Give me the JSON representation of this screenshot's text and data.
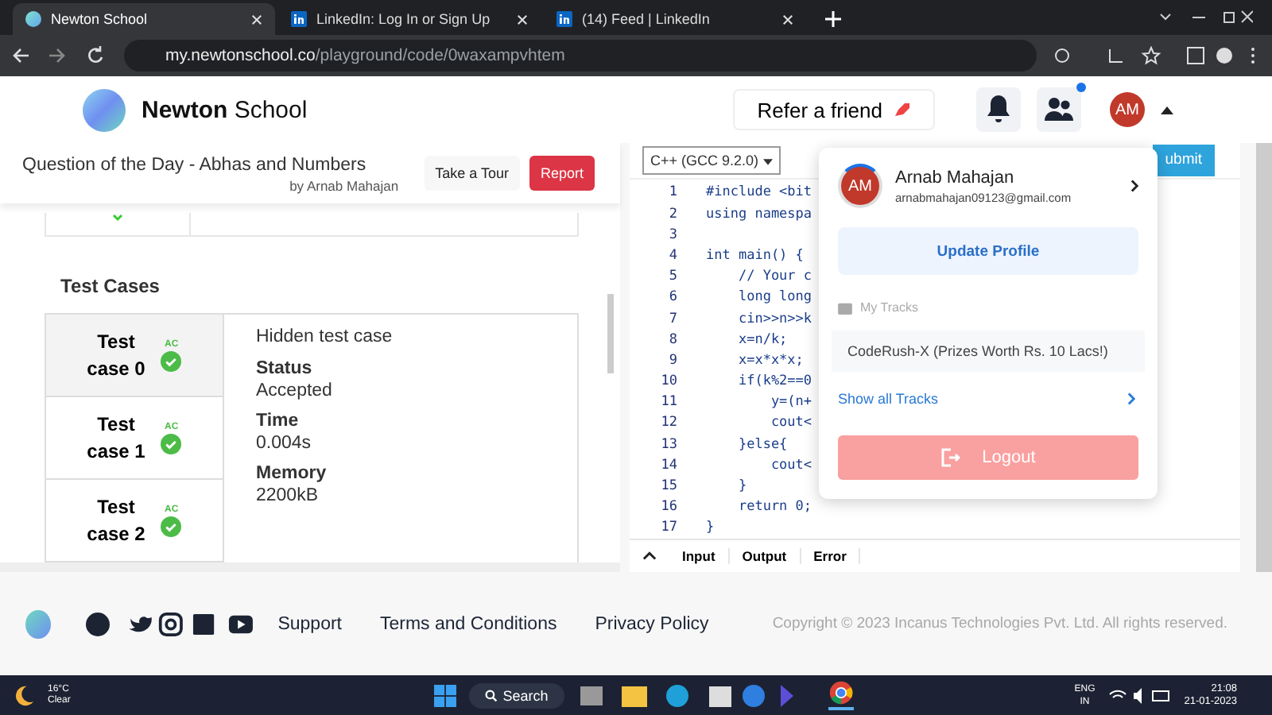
{
  "browser": {
    "tabs": [
      {
        "title": "Newton School",
        "selected": true,
        "kind": "newton"
      },
      {
        "title": "LinkedIn: Log In or Sign Up",
        "selected": false,
        "kind": "linkedin"
      },
      {
        "title": "(14) Feed | LinkedIn",
        "selected": false,
        "kind": "linkedin"
      }
    ],
    "url": {
      "host": "my.newtonschool.co",
      "path": "/playground/code/0waxampvhtem"
    }
  },
  "header": {
    "brand_bold": "Newton",
    "brand_rest": "School",
    "refer": "Refer a friend",
    "avatar": "AM"
  },
  "problem": {
    "title": "Question of the Day - Abhas and Numbers",
    "author": "by Arnab Mahajan",
    "buttons": [
      "Take a Tour",
      "Report"
    ]
  },
  "test_cases": {
    "heading": "Test Cases",
    "cases": [
      {
        "line1": "Test",
        "line2": "case 0",
        "verdict": "AC",
        "selected": true
      },
      {
        "line1": "Test",
        "line2": "case 1",
        "verdict": "AC",
        "selected": false
      },
      {
        "line1": "Test",
        "line2": "case 2",
        "verdict": "AC",
        "selected": false
      }
    ],
    "detail": {
      "description": "Hidden test case",
      "fields": [
        {
          "label": "Status",
          "value": "Accepted"
        },
        {
          "label": "Time",
          "value": "0.004s"
        },
        {
          "label": "Memory",
          "value": "2200kB"
        }
      ]
    }
  },
  "editor": {
    "language": "C++ (GCC 9.2.0)",
    "submit": "ubmit",
    "lines": [
      {
        "n": "1",
        "text": "#include <bit"
      },
      {
        "n": "2",
        "text": "using namespa"
      },
      {
        "n": "3"
      },
      {
        "n": "4",
        "text": "int main() {"
      },
      {
        "n": "5",
        "text": "    // Your c"
      },
      {
        "n": "6",
        "text": "    long long"
      },
      {
        "n": "7",
        "text": "    cin>>n>>k"
      },
      {
        "n": "8",
        "text": "    x=n/k;"
      },
      {
        "n": "9",
        "text": "    x=x*x*x;"
      },
      {
        "n": "10",
        "text": "    if(k%2==0"
      },
      {
        "n": "11",
        "text": "        y=(n+"
      },
      {
        "n": "12",
        "text": "        cout<"
      },
      {
        "n": "13",
        "text": "    }else{"
      },
      {
        "n": "14",
        "text": "        cout<"
      },
      {
        "n": "15",
        "text": "    }"
      },
      {
        "n": "16",
        "text": "    return 0;"
      },
      {
        "n": "17",
        "text": "}"
      }
    ],
    "console_tabs": [
      "Input",
      "Output",
      "Error"
    ]
  },
  "profile_menu": {
    "initials": "AM",
    "name": "Arnab Mahajan",
    "email": "arnabmahajan09123@gmail.com",
    "update": "Update Profile",
    "tracks_label": "My Tracks",
    "tracks": [
      "CodeRush-X (Prizes Worth Rs. 10 Lacs!)"
    ],
    "show_all": "Show all Tracks",
    "logout": "Logout"
  },
  "footer": {
    "links": [
      "Support",
      "Terms and Conditions",
      "Privacy Policy"
    ],
    "copyright": "Copyright © 2023 Incanus Technologies Pvt. Ltd. All rights reserved."
  },
  "taskbar": {
    "temp": "16°C",
    "condition": "Clear",
    "search": "Search",
    "lang": "ENG",
    "region": "IN",
    "time": "21:08",
    "date": "21-01-2023"
  }
}
